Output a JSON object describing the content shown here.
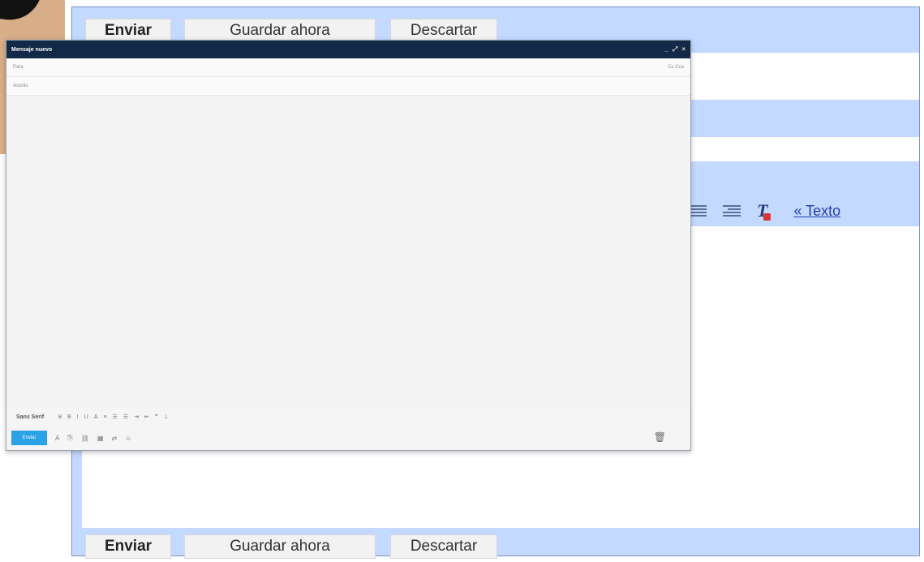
{
  "old_compose": {
    "top_toolbar": {
      "send_label": "Enviar",
      "save_label": "Guardar ahora",
      "discard_label": "Descartar"
    },
    "bottom_toolbar": {
      "send_label": "Enviar",
      "save_label": "Guardar ahora",
      "discard_label": "Descartar"
    },
    "formatting": {
      "plain_text_link": "« Texto"
    }
  },
  "popup": {
    "title": "Mensaje nuevo",
    "controls": [
      "_",
      "⤢",
      "×"
    ],
    "to_label": "Para",
    "cc_bcc_label": "Cc Cco",
    "subject_label": "Asunto",
    "font_label": "Sans Serif",
    "format_glyphs": [
      "ꓤ",
      "B",
      "I",
      "U",
      "A",
      "≡",
      "☰",
      "☰",
      "⇥",
      "⇤",
      "❞",
      "⊥"
    ],
    "send_label": "Enviar",
    "attach_glyphs": [
      "A",
      "⎘",
      "⛓",
      "▦",
      "⇄",
      "☺"
    ],
    "trash_glyph": "🗑"
  },
  "colors": {
    "old_frame": "#c3d9ff",
    "popup_titlebar": "#122a47",
    "send_button": "#2aa3e6"
  }
}
